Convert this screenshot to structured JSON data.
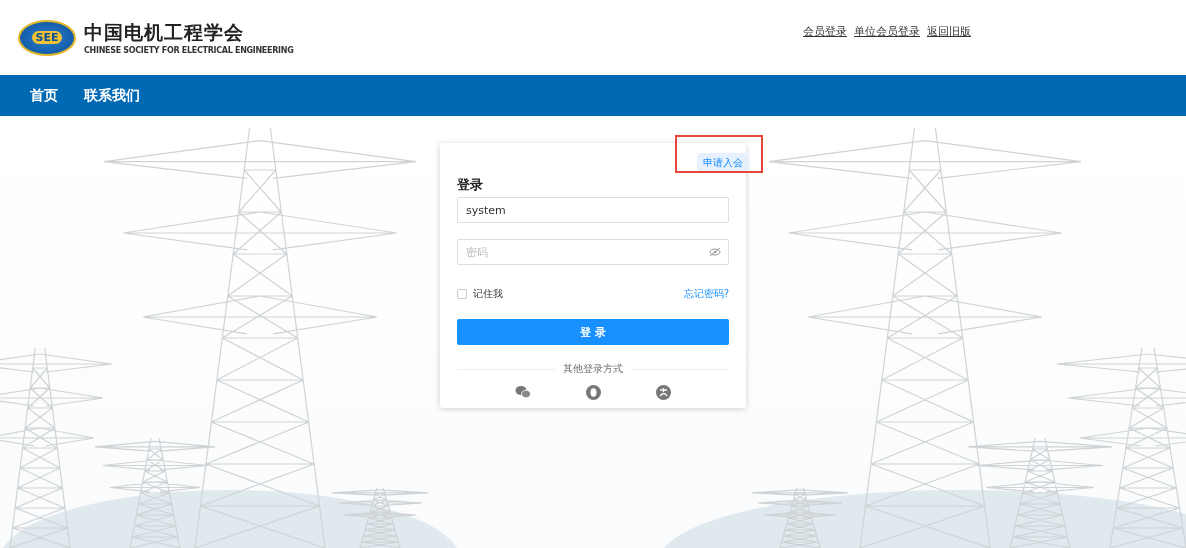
{
  "logo": {
    "badge_text": "SEE",
    "title": "中国电机工程学会",
    "subtitle": "CHINESE SOCIETY FOR ELECTRICAL ENGINEERING"
  },
  "header_links": [
    "会员登录",
    "单位会员登录",
    "返回旧版"
  ],
  "nav": [
    {
      "label": "首页"
    },
    {
      "label": "联系我们"
    }
  ],
  "login": {
    "apply_button": "申请入会",
    "apply_highlighted": true,
    "title": "登录",
    "username": {
      "value": "system"
    },
    "password": {
      "placeholder": "密码"
    },
    "remember": {
      "label": "记住我",
      "checked": false
    },
    "forgot": "忘记密码?",
    "submit": "登 录",
    "other_methods": "其他登录方式"
  }
}
